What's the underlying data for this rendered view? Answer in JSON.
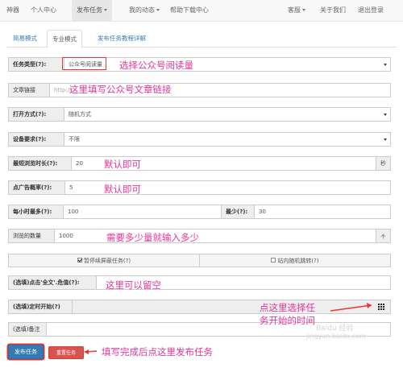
{
  "navbar": {
    "brand": "神器",
    "items": [
      "个人中心",
      "发布任务",
      "我的动态",
      "帮助下载中心"
    ],
    "right_items": [
      "客服",
      "关于我们",
      "退出登录"
    ]
  },
  "tabs": [
    "简易模式",
    "专业模式",
    "发布任务教程详解"
  ],
  "form": {
    "task_type": {
      "label": "任务类型(?):",
      "value": "公众号阅读量"
    },
    "article_link": {
      "label": "文章链接",
      "placeholder": "http://"
    },
    "open_mode": {
      "label": "打开方式(?):",
      "value": "随机方式"
    },
    "device": {
      "label": "设备要求(?):",
      "value": "不限"
    },
    "min_browse": {
      "label": "最短浏览时长(?):",
      "value": "20",
      "unit": "秒"
    },
    "ad_click_rate": {
      "label": "点广告概率(?):",
      "value": "5"
    },
    "hourly_max": {
      "label": "每小时最多(?):",
      "value": "100"
    },
    "hourly_min": {
      "label": "最少(?):",
      "value": "30"
    },
    "browse_count": {
      "label": "浏览的数量",
      "value": "1000",
      "step_icon": "arrow-up-icon"
    },
    "pause_on_lock": {
      "label": "暂停续屏蔽任务(?)",
      "checked": true
    },
    "random_jump": {
      "label": "站内随机跳转(?)",
      "checked": false
    },
    "click_text": {
      "label": "(选填)点击'全文'.危值(?):",
      "value": ""
    },
    "schedule_start": {
      "label": "(选填)定时开始(?)",
      "value": "",
      "icon": "calendar-icon"
    },
    "remark": {
      "label": "(选填)备注",
      "value": ""
    },
    "submit_label": "发布任务",
    "reset_label": "重置任务"
  },
  "annotations": [
    "选择公众号阅读量",
    "这里填写公众号文章链接",
    "默认即可",
    "默认即可",
    "需要多少量就输入多少",
    "这里可以留空",
    "点这里选择任",
    "务开始的时间",
    "填写完成后点这里发布任务"
  ],
  "watermark": [
    "Baidu 经验",
    "jingyan.baidu.com"
  ],
  "colors": {
    "annotation": "#e0359a",
    "primary": "#337ab7",
    "danger": "#d9534f",
    "highlight_box": "#e33"
  }
}
